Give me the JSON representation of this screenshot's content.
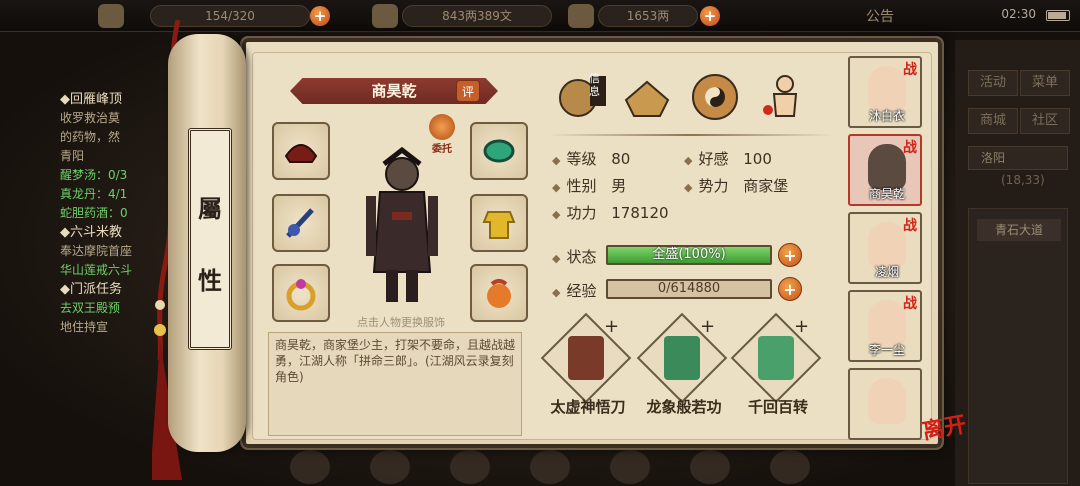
{
  "topbar": {
    "res1_value": "154/320",
    "res2_value": "843两389文",
    "res3_value": "1653两",
    "notice_label": "公告",
    "clock": "02:30"
  },
  "background_left": {
    "lines": [
      {
        "text": "◆回雁峰顶",
        "style": "hd"
      },
      {
        "text": "收罗救治莫",
        "style": ""
      },
      {
        "text": "的药物，然",
        "style": ""
      },
      {
        "text": "青阳",
        "style": ""
      },
      {
        "text": "醒梦汤：0/3",
        "style": "gr"
      },
      {
        "text": "真龙丹：4/1",
        "style": "gr"
      },
      {
        "text": "蛇胆药酒：0",
        "style": "gr"
      },
      {
        "text": "◆六斗米教",
        "style": "hd"
      },
      {
        "text": "奉达摩院首座",
        "style": ""
      },
      {
        "text": "华山莲戒六斗",
        "style": "gr"
      },
      {
        "text": "◆门派任务",
        "style": "hd"
      },
      {
        "text": "去双王殿预",
        "style": "gr"
      },
      {
        "text": "地住持宣",
        "style": ""
      }
    ]
  },
  "background_right": {
    "btn_huodong": "活动",
    "btn_caidan": "菜单",
    "btn_shangcheng": "商城",
    "btn_shequ": "社区",
    "city": "洛阳",
    "coords": "(18,33)",
    "road": "青石大道"
  },
  "scroll": {
    "seal_char1": "屬",
    "seal_char2": "性"
  },
  "character": {
    "name": "商昊乾",
    "ping": "评",
    "weituo": "委托",
    "hint": "点击人物更换服饰",
    "description": "商昊乾，商家堡少主，打架不要命，且越战越勇，江湖人称「拼命三郎」。(江湖风云录复刻角色)"
  },
  "info_icons": {
    "xinqi_label": "信息"
  },
  "stats": {
    "level_label": "等级",
    "level_value": "80",
    "favor_label": "好感",
    "favor_value": "100",
    "gender_label": "性别",
    "gender_value": "男",
    "faction_label": "势力",
    "faction_value": "商家堡",
    "power_label": "功力",
    "power_value": "178120",
    "status_label": "状态",
    "status_text": "全盛(100%)",
    "status_fill": 1.0,
    "exp_label": "经验",
    "exp_text": "0/614880",
    "exp_fill": 0.0
  },
  "skills": [
    {
      "name": "太虚神悟刀",
      "plus": "+"
    },
    {
      "name": "龙象般若功",
      "plus": "+"
    },
    {
      "name": "千回百转",
      "plus": "+"
    }
  ],
  "roster": [
    {
      "name": "沐白衣",
      "zhan": "战"
    },
    {
      "name": "商昊乾",
      "zhan": "战"
    },
    {
      "name": "凌烟",
      "zhan": "战"
    },
    {
      "name": "李一尘",
      "zhan": "战"
    },
    {
      "name": "",
      "zhan": ""
    }
  ],
  "leave_label": "离开",
  "plus_sign": "+",
  "colors": {
    "accent_red": "#b23a2a",
    "status_green": "#3f9b34",
    "parchment": "#ebdfc4"
  }
}
